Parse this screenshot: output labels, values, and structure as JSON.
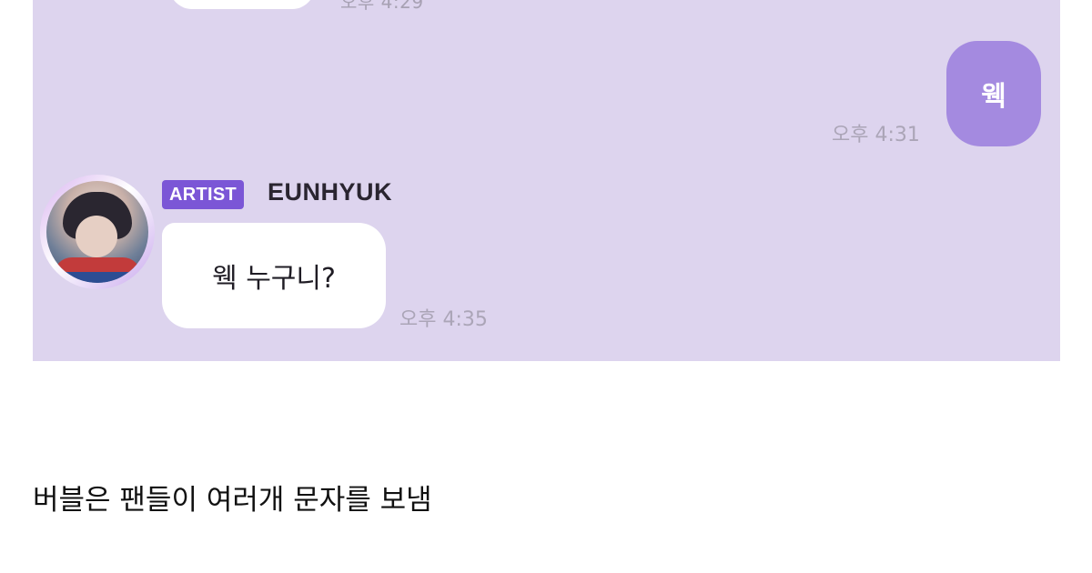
{
  "chat": {
    "messages": [
      {
        "side": "left",
        "text": "",
        "time": "오후 4:29"
      },
      {
        "side": "right",
        "text": "웩",
        "time": "오후 4:31"
      },
      {
        "side": "left",
        "text": "웩 누구니?",
        "time": "오후 4:35"
      }
    ],
    "artist_badge": "ARTIST",
    "artist_name": "EUNHYUK"
  },
  "caption": "버블은 팬들이 여러개 문자를 보냄",
  "colors": {
    "chat_background": "#ddd4ee",
    "sent_bubble": "#a48ae0",
    "badge": "#7b56d6"
  }
}
